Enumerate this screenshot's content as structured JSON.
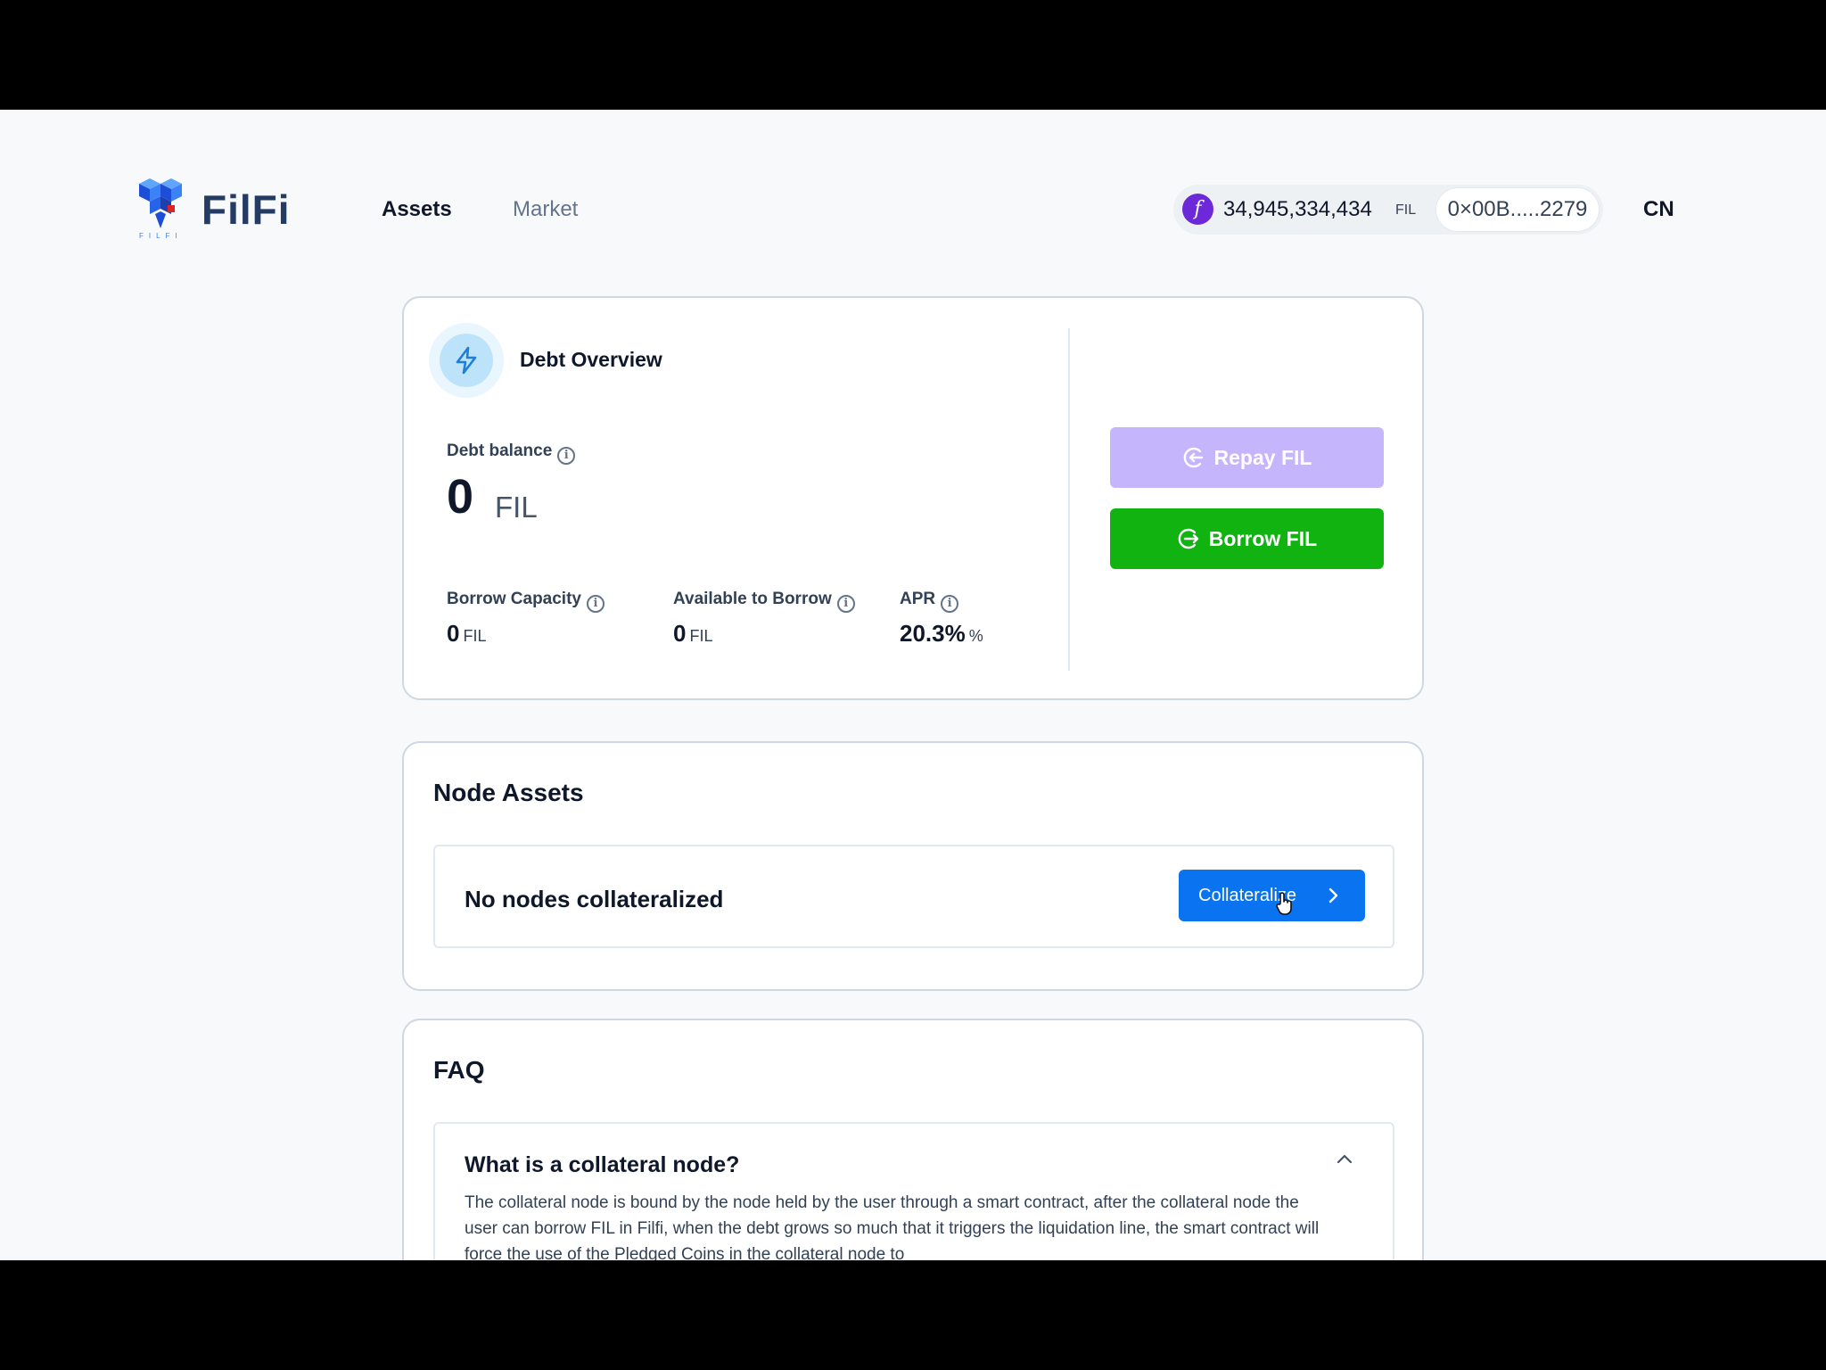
{
  "brand": {
    "name": "FilFi",
    "tagline": "FILFI"
  },
  "nav": {
    "assets": "Assets",
    "market": "Market"
  },
  "wallet": {
    "fil_glyph": "f",
    "balance": "34,945,334,434",
    "unit": "FIL",
    "address": "0×00B.....2279"
  },
  "language": "CN",
  "debt": {
    "title": "Debt Overview",
    "balance_label": "Debt balance",
    "balance_value": "0",
    "balance_unit": "FIL",
    "capacity_label": "Borrow Capacity",
    "capacity_value": "0",
    "capacity_unit": "FIL",
    "available_label": "Available to Borrow",
    "available_value": "0",
    "available_unit": "FIL",
    "apr_label": "APR",
    "apr_value": "20.3%",
    "apr_unit": "%",
    "repay_label": "Repay FIL",
    "borrow_label": "Borrow FIL",
    "info_glyph": "i"
  },
  "nodes": {
    "title": "Node Assets",
    "empty": "No nodes collateralized",
    "collateralize_label": "Collateralize"
  },
  "faq": {
    "title": "FAQ",
    "question": "What is a collateral node?",
    "answer": "The collateral node is bound by the node held by the user through a smart contract, after the collateral node the user can borrow FIL in Filfi, when the debt grows so much that it triggers the liquidation line, the smart contract will force the use of the Pledged Coins in the collateral node to"
  },
  "colors": {
    "accent_blue": "#0a74f0",
    "borrow_green": "#10b310",
    "repay_disabled": "#c4b5fd",
    "fil_purple": "#6d28d9"
  },
  "icons": [
    "filfi-logo",
    "fil-coin-icon",
    "bolt-icon",
    "info-icon",
    "repay-icon",
    "borrow-icon",
    "chevron-right-icon",
    "chevron-up-icon",
    "cursor-hand-icon"
  ]
}
